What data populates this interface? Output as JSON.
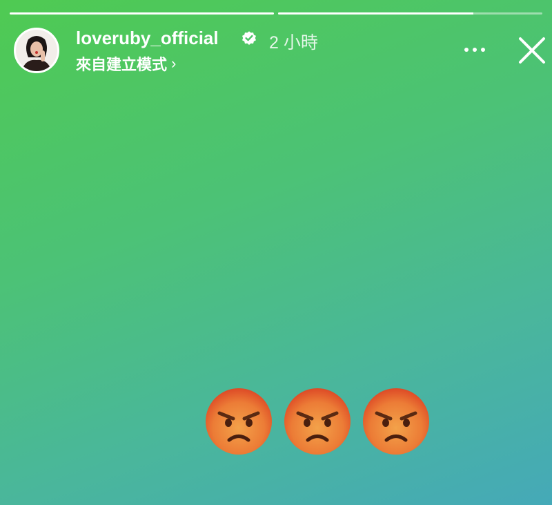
{
  "story": {
    "progress": [
      1,
      0.74
    ]
  },
  "header": {
    "username": "loveruby_official",
    "time": "2 小時",
    "subline": "來自建立模式",
    "chevron": "›",
    "icons": {
      "verified": "verified-badge-icon",
      "more": "more-options-icon",
      "close": "close-icon"
    }
  },
  "content": {
    "emojis": [
      "angry-face",
      "angry-face",
      "angry-face"
    ]
  },
  "colors": {
    "gradient_top_left": "#4fca52",
    "gradient_bottom_right": "#45a9b8",
    "emoji_face": "#f08a3c",
    "emoji_face_top": "#e4512d"
  }
}
